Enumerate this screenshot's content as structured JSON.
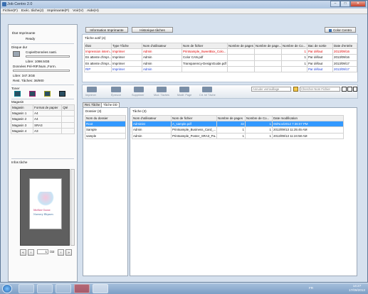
{
  "window": {
    "title": "Job Centro 2.0",
    "min": "–",
    "max": "□",
    "close": "✕"
  },
  "menu": [
    "Fichier(F)",
    "Exéc. tâche(J)",
    "Imprimante(P)",
    "Voir(V)",
    "Aide(H)"
  ],
  "left": {
    "printer_state_label": "État Imprimante",
    "printer_state_value": "Ready",
    "hdd_title": "Disque dur",
    "copy_label": "Copie/Données nasti.",
    "copy_free": "Libre: 1098.5GB",
    "rip_label": "Données Pré-RIP,Num.,Form.",
    "rip_free": "Libre: 347.3GB",
    "rip_tasks": "Rest. Tâches: 36/900",
    "toner_title": "Toner",
    "tray_title": "Magasin",
    "tray_headers": [
      "Magasin",
      "Format de papier",
      "Qté"
    ],
    "trays": [
      {
        "name": "Magasin 1",
        "format": "A4"
      },
      {
        "name": "Magasin 2",
        "format": "A4"
      },
      {
        "name": "Magasin 3",
        "format": "SRA3"
      },
      {
        "name": "Magasin 4",
        "format": "A3"
      }
    ],
    "info_title": "Infos tâche",
    "page_current": "1",
    "page_total": "/32",
    "nav": [
      "«",
      "‹",
      "›",
      "»"
    ]
  },
  "top_tabs": {
    "info": "Information Imprimante",
    "history": "Historique tâches",
    "color": "Color Centro"
  },
  "active": {
    "title": "Tâche actif (4)",
    "headers": [
      "État",
      "Type Tâche",
      "Nom d'utilisateur",
      "Nom de fichier",
      "Nombre de pages",
      "Nombre de page...",
      "Nombre de Co...",
      "Bac de sortie",
      "Date d'entrée"
    ],
    "rows": [
      {
        "state": "Impression intern...",
        "type": "Imprimer",
        "user": "Admin",
        "file": "Printsample_SweetBox_Colo...",
        "pages": "",
        "pp": "",
        "copies": "1",
        "tray": "Par défaut",
        "date": "2013/09/16",
        "color": "red"
      },
      {
        "state": "En attente d'impr...",
        "type": "Imprimer",
        "user": "Admin",
        "file": "Color CAN.pdf",
        "pages": "",
        "pp": "",
        "copies": "1",
        "tray": "Par défaut",
        "date": "2013/09/16",
        "color": "black"
      },
      {
        "state": "En attente d'impr...",
        "type": "Imprimer",
        "user": "Admin",
        "file": "Transparency-DesignGuide.pdf",
        "pages": "",
        "pp": "",
        "copies": "1",
        "tray": "Par défaut",
        "date": "2013/09/17",
        "color": "black"
      },
      {
        "state": "RIP",
        "type": "Imprimer",
        "user": "Admin",
        "file": "",
        "pages": "",
        "pp": "",
        "copies": "",
        "tray": "Par défaut",
        "date": "2013/09/17",
        "color": "blue"
      }
    ]
  },
  "toolbar": {
    "buttons": [
      "Imprimer",
      "Épreuve",
      "Supprimer",
      "Mod. Tâches",
      "Modif. Page",
      "Crt. tel Tâche"
    ],
    "locked_placeholder": "Annuler verrouillage",
    "search_placeholder": "Chercher Nom Fichier"
  },
  "bottom_tabs": [
    "Ret. Tâche",
    "Tâche DD"
  ],
  "folder": {
    "title": "Dossier (3)",
    "header": "Nom du dossier",
    "items": [
      "Root",
      "Sample",
      "sample"
    ]
  },
  "jobs": {
    "title": "Tâche (3)",
    "headers": [
      "Nom d'utilisateur",
      "Nom de fichier",
      "Nombre de pages",
      "Nombre de Co...",
      "Date modification"
    ],
    "rows": [
      {
        "user": "Administ",
        "file": "A_sample.pdf",
        "pages": "32",
        "copies": "1",
        "date": "06/Nov/2012 7:36:07 PM",
        "selected": true
      },
      {
        "user": "Admin",
        "file": "Printsample_Business_Card_...",
        "pages": "1",
        "copies": "1",
        "date": "2013/09/13 11:25:45 AM",
        "selected": false
      },
      {
        "user": "Admin",
        "file": "Printsample_Poster_SRA3_Pa...",
        "pages": "1",
        "copies": "1",
        "date": "2013/09/13 11:24:58 AM",
        "selected": false
      }
    ]
  },
  "taskbar": {
    "lang": "FR",
    "time": "14:27",
    "date": "17/09/2013"
  },
  "preview": {
    "caption1": "Mother Goose",
    "caption2": "Nursery Rhymes"
  }
}
